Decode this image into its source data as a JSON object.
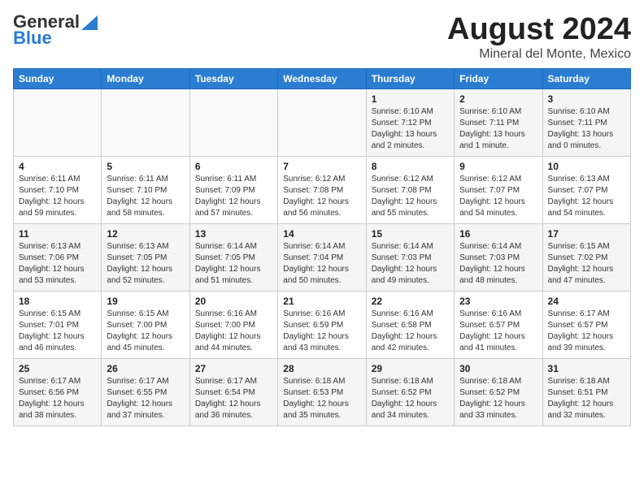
{
  "logo": {
    "line1": "General",
    "line2": "Blue"
  },
  "title": "August 2024",
  "subtitle": "Mineral del Monte, Mexico",
  "days_of_week": [
    "Sunday",
    "Monday",
    "Tuesday",
    "Wednesday",
    "Thursday",
    "Friday",
    "Saturday"
  ],
  "weeks": [
    [
      {
        "day": "",
        "info": ""
      },
      {
        "day": "",
        "info": ""
      },
      {
        "day": "",
        "info": ""
      },
      {
        "day": "",
        "info": ""
      },
      {
        "day": "1",
        "info": "Sunrise: 6:10 AM\nSunset: 7:12 PM\nDaylight: 13 hours and 2 minutes."
      },
      {
        "day": "2",
        "info": "Sunrise: 6:10 AM\nSunset: 7:11 PM\nDaylight: 13 hours and 1 minute."
      },
      {
        "day": "3",
        "info": "Sunrise: 6:10 AM\nSunset: 7:11 PM\nDaylight: 13 hours and 0 minutes."
      }
    ],
    [
      {
        "day": "4",
        "info": "Sunrise: 6:11 AM\nSunset: 7:10 PM\nDaylight: 12 hours and 59 minutes."
      },
      {
        "day": "5",
        "info": "Sunrise: 6:11 AM\nSunset: 7:10 PM\nDaylight: 12 hours and 58 minutes."
      },
      {
        "day": "6",
        "info": "Sunrise: 6:11 AM\nSunset: 7:09 PM\nDaylight: 12 hours and 57 minutes."
      },
      {
        "day": "7",
        "info": "Sunrise: 6:12 AM\nSunset: 7:08 PM\nDaylight: 12 hours and 56 minutes."
      },
      {
        "day": "8",
        "info": "Sunrise: 6:12 AM\nSunset: 7:08 PM\nDaylight: 12 hours and 55 minutes."
      },
      {
        "day": "9",
        "info": "Sunrise: 6:12 AM\nSunset: 7:07 PM\nDaylight: 12 hours and 54 minutes."
      },
      {
        "day": "10",
        "info": "Sunrise: 6:13 AM\nSunset: 7:07 PM\nDaylight: 12 hours and 54 minutes."
      }
    ],
    [
      {
        "day": "11",
        "info": "Sunrise: 6:13 AM\nSunset: 7:06 PM\nDaylight: 12 hours and 53 minutes."
      },
      {
        "day": "12",
        "info": "Sunrise: 6:13 AM\nSunset: 7:05 PM\nDaylight: 12 hours and 52 minutes."
      },
      {
        "day": "13",
        "info": "Sunrise: 6:14 AM\nSunset: 7:05 PM\nDaylight: 12 hours and 51 minutes."
      },
      {
        "day": "14",
        "info": "Sunrise: 6:14 AM\nSunset: 7:04 PM\nDaylight: 12 hours and 50 minutes."
      },
      {
        "day": "15",
        "info": "Sunrise: 6:14 AM\nSunset: 7:03 PM\nDaylight: 12 hours and 49 minutes."
      },
      {
        "day": "16",
        "info": "Sunrise: 6:14 AM\nSunset: 7:03 PM\nDaylight: 12 hours and 48 minutes."
      },
      {
        "day": "17",
        "info": "Sunrise: 6:15 AM\nSunset: 7:02 PM\nDaylight: 12 hours and 47 minutes."
      }
    ],
    [
      {
        "day": "18",
        "info": "Sunrise: 6:15 AM\nSunset: 7:01 PM\nDaylight: 12 hours and 46 minutes."
      },
      {
        "day": "19",
        "info": "Sunrise: 6:15 AM\nSunset: 7:00 PM\nDaylight: 12 hours and 45 minutes."
      },
      {
        "day": "20",
        "info": "Sunrise: 6:16 AM\nSunset: 7:00 PM\nDaylight: 12 hours and 44 minutes."
      },
      {
        "day": "21",
        "info": "Sunrise: 6:16 AM\nSunset: 6:59 PM\nDaylight: 12 hours and 43 minutes."
      },
      {
        "day": "22",
        "info": "Sunrise: 6:16 AM\nSunset: 6:58 PM\nDaylight: 12 hours and 42 minutes."
      },
      {
        "day": "23",
        "info": "Sunrise: 6:16 AM\nSunset: 6:57 PM\nDaylight: 12 hours and 41 minutes."
      },
      {
        "day": "24",
        "info": "Sunrise: 6:17 AM\nSunset: 6:57 PM\nDaylight: 12 hours and 39 minutes."
      }
    ],
    [
      {
        "day": "25",
        "info": "Sunrise: 6:17 AM\nSunset: 6:56 PM\nDaylight: 12 hours and 38 minutes."
      },
      {
        "day": "26",
        "info": "Sunrise: 6:17 AM\nSunset: 6:55 PM\nDaylight: 12 hours and 37 minutes."
      },
      {
        "day": "27",
        "info": "Sunrise: 6:17 AM\nSunset: 6:54 PM\nDaylight: 12 hours and 36 minutes."
      },
      {
        "day": "28",
        "info": "Sunrise: 6:18 AM\nSunset: 6:53 PM\nDaylight: 12 hours and 35 minutes."
      },
      {
        "day": "29",
        "info": "Sunrise: 6:18 AM\nSunset: 6:52 PM\nDaylight: 12 hours and 34 minutes."
      },
      {
        "day": "30",
        "info": "Sunrise: 6:18 AM\nSunset: 6:52 PM\nDaylight: 12 hours and 33 minutes."
      },
      {
        "day": "31",
        "info": "Sunrise: 6:18 AM\nSunset: 6:51 PM\nDaylight: 12 hours and 32 minutes."
      }
    ]
  ]
}
